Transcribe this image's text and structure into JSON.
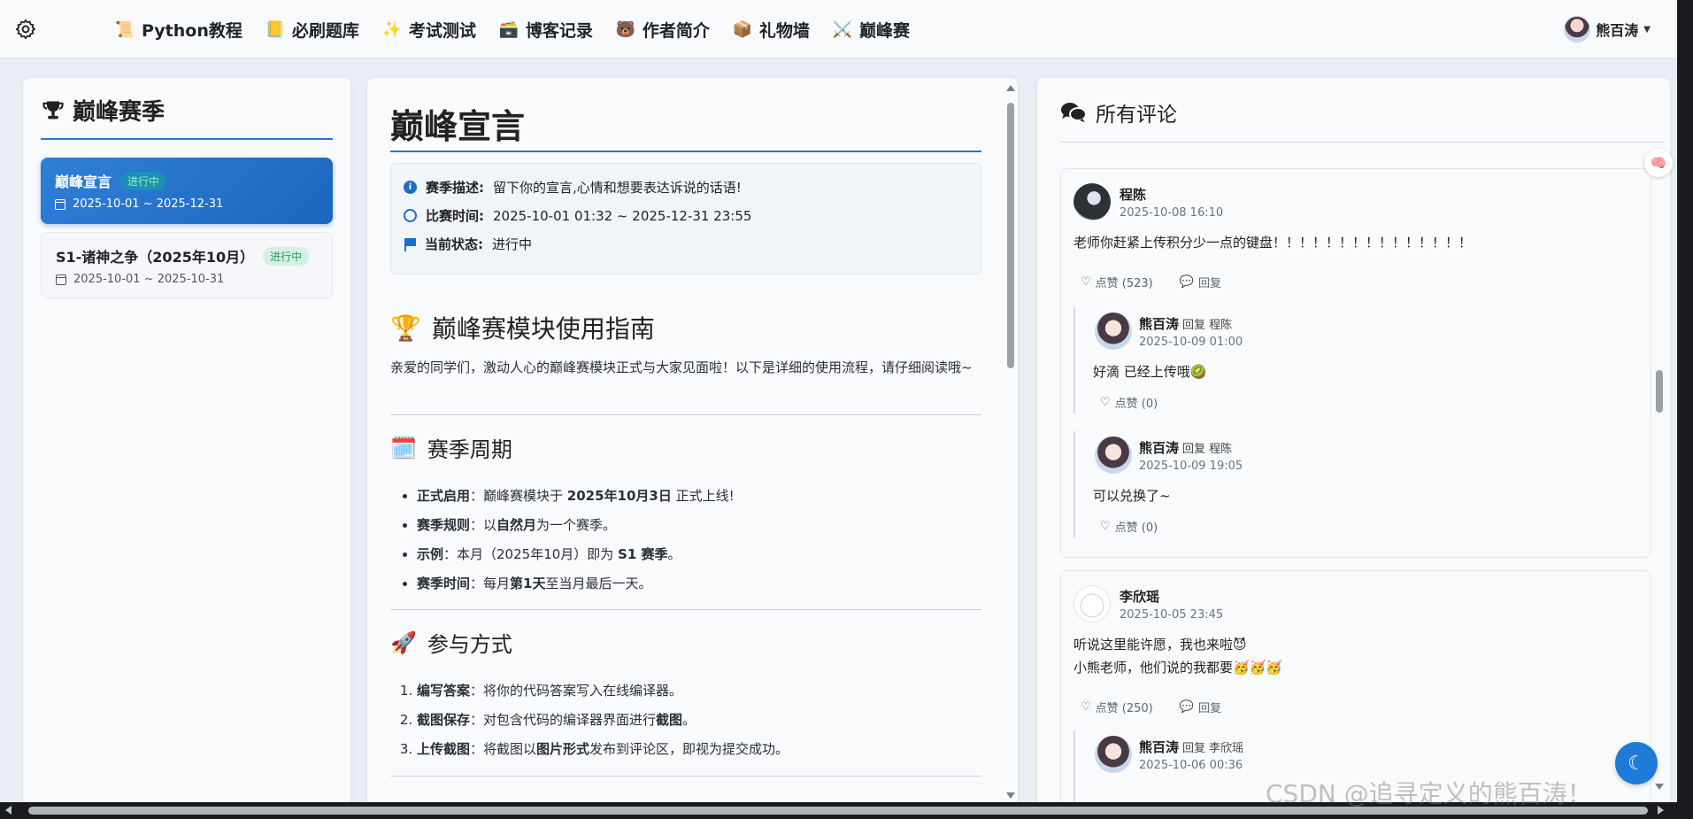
{
  "nav": {
    "links": [
      {
        "icon": "📜",
        "label": "Python教程"
      },
      {
        "icon": "📒",
        "label": "必刷题库"
      },
      {
        "icon": "✨",
        "label": "考试测试"
      },
      {
        "icon": "🗃️",
        "label": "博客记录"
      },
      {
        "icon": "🐻",
        "label": "作者简介"
      },
      {
        "icon": "📦",
        "label": "礼物墙"
      },
      {
        "icon": "⚔️",
        "label": "巅峰赛"
      }
    ],
    "user": "熊百涛"
  },
  "left": {
    "title": "巅峰赛季",
    "seasons": [
      {
        "name": "巅峰宣言",
        "badge": "进行中",
        "date": "2025-10-01 ~ 2025-12-31"
      },
      {
        "name": "S1-诸神之争（2025年10月）",
        "badge": "进行中",
        "date": "2025-10-01 ~ 2025-10-31"
      }
    ]
  },
  "middle": {
    "title": "巅峰宣言",
    "info": {
      "desc_label": "赛季描述:",
      "desc": "留下你的宣言,心情和想要表达诉说的话语!",
      "time_label": "比赛时间:",
      "time": "2025-10-01 01:32 ~ 2025-12-31 23:55",
      "status_label": "当前状态:",
      "status": "进行中"
    },
    "guide": {
      "icon": "🏆",
      "title": "巅峰赛模块使用指南",
      "intro": "亲爱的同学们，激动人心的巅峰赛模块正式与大家见面啦！以下是详细的使用流程，请仔细阅读哦~"
    },
    "cycle": {
      "icon": "🗓️",
      "title": "赛季周期",
      "items": [
        {
          "label": "正式启用",
          "text": "：巅峰赛模块于 ",
          "bold": "2025年10月3日",
          "tail": " 正式上线!"
        },
        {
          "label": "赛季规则",
          "text": "：以",
          "bold": "自然月",
          "tail": "为一个赛季。"
        },
        {
          "label": "示例",
          "text": "：本月（2025年10月）即为 ",
          "bold": "S1 赛季",
          "tail": "。"
        },
        {
          "label": "赛季时间",
          "text": "：每月",
          "bold": "第1天",
          "tail": "至当月最后一天。"
        }
      ]
    },
    "join": {
      "icon": "🚀",
      "title": "参与方式",
      "items": [
        {
          "label": "编写答案",
          "text": "：将你的代码答案写入在线编译器。",
          "bold": "",
          "tail": ""
        },
        {
          "label": "截图保存",
          "text": "：对包含代码的编译器界面进行",
          "bold": "截图",
          "tail": "。"
        },
        {
          "label": "上传截图",
          "text": "：将截图以",
          "bold": "图片形式",
          "tail": "发布到评论区，即视为提交成功。"
        }
      ]
    }
  },
  "right": {
    "title": "所有评论",
    "comments": [
      {
        "name": "程陈",
        "time": "2025-10-08 16:10",
        "text": "老师你赶紧上传积分少一点的键盘！！！！！！！！！！！！！！！",
        "like": "点赞 (523)",
        "reply": "回复",
        "replies": [
          {
            "name": "熊百涛",
            "reply_to": "回复 程陈",
            "time": "2025-10-09 01:00",
            "text": "好滴 已经上传哦🥝",
            "like": "点赞 (0)"
          },
          {
            "name": "熊百涛",
            "reply_to": "回复 程陈",
            "time": "2025-10-09 19:05",
            "text": "可以兑换了~",
            "like": "点赞 (0)"
          }
        ]
      },
      {
        "name": "李欣瑶",
        "time": "2025-10-05 23:45",
        "text1": "听说这里能许愿，我也来啦😈",
        "text2": "小熊老师，他们说的我都要🥳🥳🥳",
        "like": "点赞 (250)",
        "reply": "回复",
        "replies": [
          {
            "name": "熊百涛",
            "reply_to": "回复 李欣瑶",
            "time": "2025-10-06 00:36"
          }
        ]
      }
    ]
  },
  "watermark": "CSDN @追寻定义的熊百涛！"
}
